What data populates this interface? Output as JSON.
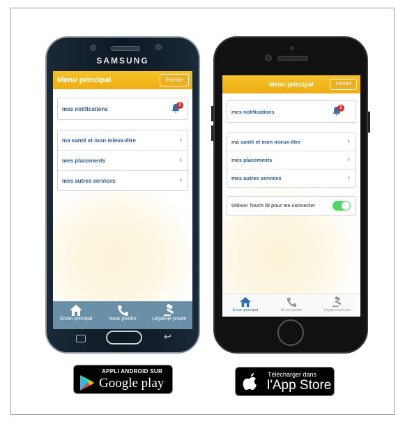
{
  "android": {
    "brand": "SAMSUNG",
    "menu_title": "Menu principal",
    "close_label": "Fermer",
    "notifications": {
      "label": "mes notifications",
      "count": "1"
    },
    "items": [
      {
        "label": "ma santé et mon mieux-être"
      },
      {
        "label": "mes placements"
      },
      {
        "label": "mes autres services"
      }
    ],
    "tabs": [
      {
        "label": "Écran principal",
        "icon": "home-icon"
      },
      {
        "label": "Nous joindre",
        "icon": "phone-icon"
      },
      {
        "label": "Légal/vie privée",
        "icon": "gavel-icon"
      }
    ]
  },
  "iphone": {
    "menu_title": "Menu principal",
    "close_label": "Fermer",
    "notifications": {
      "label": "mes notifications",
      "count": "1"
    },
    "items": [
      {
        "label": "ma santé et mon mieux-être"
      },
      {
        "label": "mes placements"
      },
      {
        "label": "mes autres services"
      }
    ],
    "touch_id": {
      "label": "Utiliser Touch ID pour me connecter",
      "enabled": true
    },
    "tabs": [
      {
        "label": "Écran principal",
        "icon": "home-icon"
      },
      {
        "label": "Nous joindre",
        "icon": "phone-icon"
      },
      {
        "label": "Légal/vie privée",
        "icon": "gavel-icon"
      }
    ]
  },
  "badges": {
    "google": {
      "top": "APPLI ANDROID SUR",
      "main": "Google play"
    },
    "apple": {
      "top": "Télécharger dans",
      "main": "l'App Store"
    }
  },
  "colors": {
    "accent": "#f2b51f",
    "link": "#2b5b8f",
    "toggle": "#4cd964",
    "badge": "#e02424",
    "android_tabbar": "#6a8fa8"
  }
}
